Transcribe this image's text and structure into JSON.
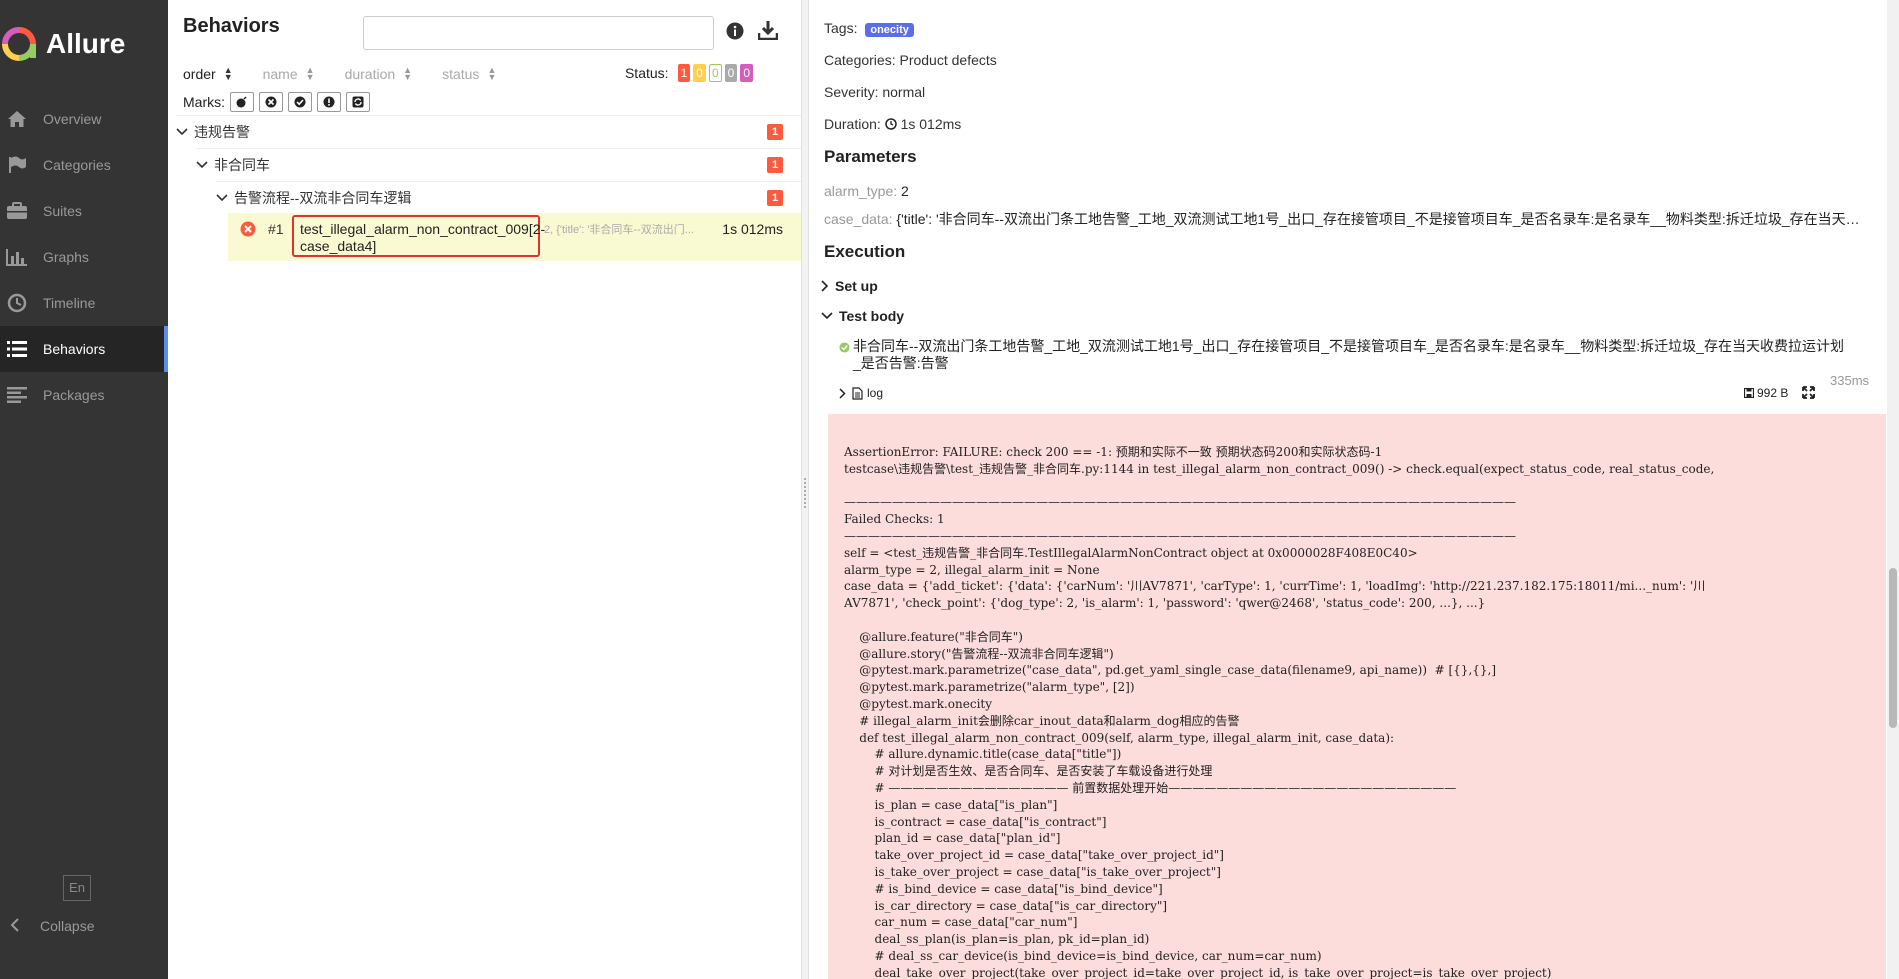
{
  "sidebar": {
    "logo_text": "Allure",
    "items": [
      {
        "label": "Overview",
        "icon": "home-icon"
      },
      {
        "label": "Categories",
        "icon": "flag-icon"
      },
      {
        "label": "Suites",
        "icon": "briefcase-icon"
      },
      {
        "label": "Graphs",
        "icon": "bar-chart-icon"
      },
      {
        "label": "Timeline",
        "icon": "clock-icon"
      },
      {
        "label": "Behaviors",
        "icon": "list-icon",
        "active": true
      },
      {
        "label": "Packages",
        "icon": "align-left-icon"
      }
    ],
    "lang": "En",
    "collapse": "Collapse"
  },
  "behaviors": {
    "title": "Behaviors",
    "search_value": "",
    "sort": {
      "order": "order",
      "name": "name",
      "duration": "duration",
      "status": "status"
    },
    "status_label": "Status:",
    "status_counts": [
      {
        "value": "1",
        "color": "#fd5a3e"
      },
      {
        "value": "0",
        "color": "#ffd050"
      },
      {
        "value": "0",
        "color": "#97cc64"
      },
      {
        "value": "0",
        "color": "#aaaaaa"
      },
      {
        "value": "0",
        "color": "#d35ebe"
      }
    ],
    "marks_label": "Marks:",
    "tree": {
      "epic": {
        "label": "违规告警",
        "count": "1"
      },
      "feature": {
        "label": "非合同车",
        "count": "1"
      },
      "story": {
        "label": "告警流程--双流非合同车逻辑",
        "count": "1"
      },
      "test": {
        "num": "#1",
        "name": "test_illegal_alarm_non_contract_009[2-case_data4]",
        "params": "2, {'title': '非合同车--双流出门...",
        "duration": "1s 012ms"
      }
    }
  },
  "detail": {
    "tags_label": "Tags:",
    "tag": "onecity",
    "categories_label": "Categories:",
    "categories_value": "Product defects",
    "severity_label": "Severity:",
    "severity_value": "normal",
    "duration_label": "Duration:",
    "duration_value": "1s 012ms",
    "parameters_heading": "Parameters",
    "param1_key": "alarm_type:",
    "param1_value": "2",
    "param2_key": "case_data:",
    "param2_value": "{'title': '非合同车--双流出门条工地告警_工地_双流测试工地1号_出口_存在接管项目_不是接管项目车_是否名录车:是名录车__物料类型:拆迁垃圾_存在当天…",
    "execution_heading": "Execution",
    "setup_label": "Set up",
    "testbody_label": "Test body",
    "step_text": "非合同车--双流出门条工地告警_工地_双流测试工地1号_出口_存在接管项目_不是接管项目车_是否名录车:是名录车__物料类型:拆迁垃圾_存在当天收费拉运计划_是否告警:告警",
    "step_time": "335ms",
    "log_label": "log",
    "log_size": "992 B",
    "error_text": "AssertionError: FAILURE: check 200 == -1: 预期和实际不一致 预期状态码200和实际状态码-1\ntestcase\\违规告警\\test_违规告警_非合同车.py:1144 in test_illegal_alarm_non_contract_009() -> check.equal(expect_status_code, real_status_code,\n\n————————————————————————————————————————————————————————\nFailed Checks: 1\n————————————————————————————————————————————————————————\nself = <test_违规告警_非合同车.TestIllegalAlarmNonContract object at 0x0000028F408E0C40>\nalarm_type = 2, illegal_alarm_init = None\ncase_data = {'add_ticket': {'data': {'carNum': '川AV7871', 'carType': 1, 'currTime': 1, 'loadImg': 'http://221.237.182.175:18011/mi..._num': '川\nAV7871', 'check_point': {'dog_type': 2, 'is_alarm': 1, 'password': 'qwer@2468', 'status_code': 200, ...}, ...}\n\n    @allure.feature(\"非合同车\")\n    @allure.story(\"告警流程--双流非合同车逻辑\")\n    @pytest.mark.parametrize(\"case_data\", pd.get_yaml_single_case_data(filename9, api_name))  # [{},{},]\n    @pytest.mark.parametrize(\"alarm_type\", [2])\n    @pytest.mark.onecity\n    # illegal_alarm_init会删除car_inout_data和alarm_dog相应的告警\n    def test_illegal_alarm_non_contract_009(self, alarm_type, illegal_alarm_init, case_data):\n        # allure.dynamic.title(case_data[\"title\"])\n        # 对计划是否生效、是否合同车、是否安装了车载设备进行处理\n        # ——————————————— 前置数据处理开始————————————————————————\n        is_plan = case_data[\"is_plan\"]\n        is_contract = case_data[\"is_contract\"]\n        plan_id = case_data[\"plan_id\"]\n        take_over_project_id = case_data[\"take_over_project_id\"]\n        is_take_over_project = case_data[\"is_take_over_project\"]\n        # is_bind_device = case_data[\"is_bind_device\"]\n        is_car_directory = case_data[\"is_car_directory\"]\n        car_num = case_data[\"car_num\"]\n        deal_ss_plan(is_plan=is_plan, pk_id=plan_id)\n        # deal_ss_car_device(is_bind_device=is_bind_device, car_num=car_num)\n        deal_take_over_project(take_over_project_id=take_over_project_id, is_take_over_project=is_take_over_project)"
  }
}
